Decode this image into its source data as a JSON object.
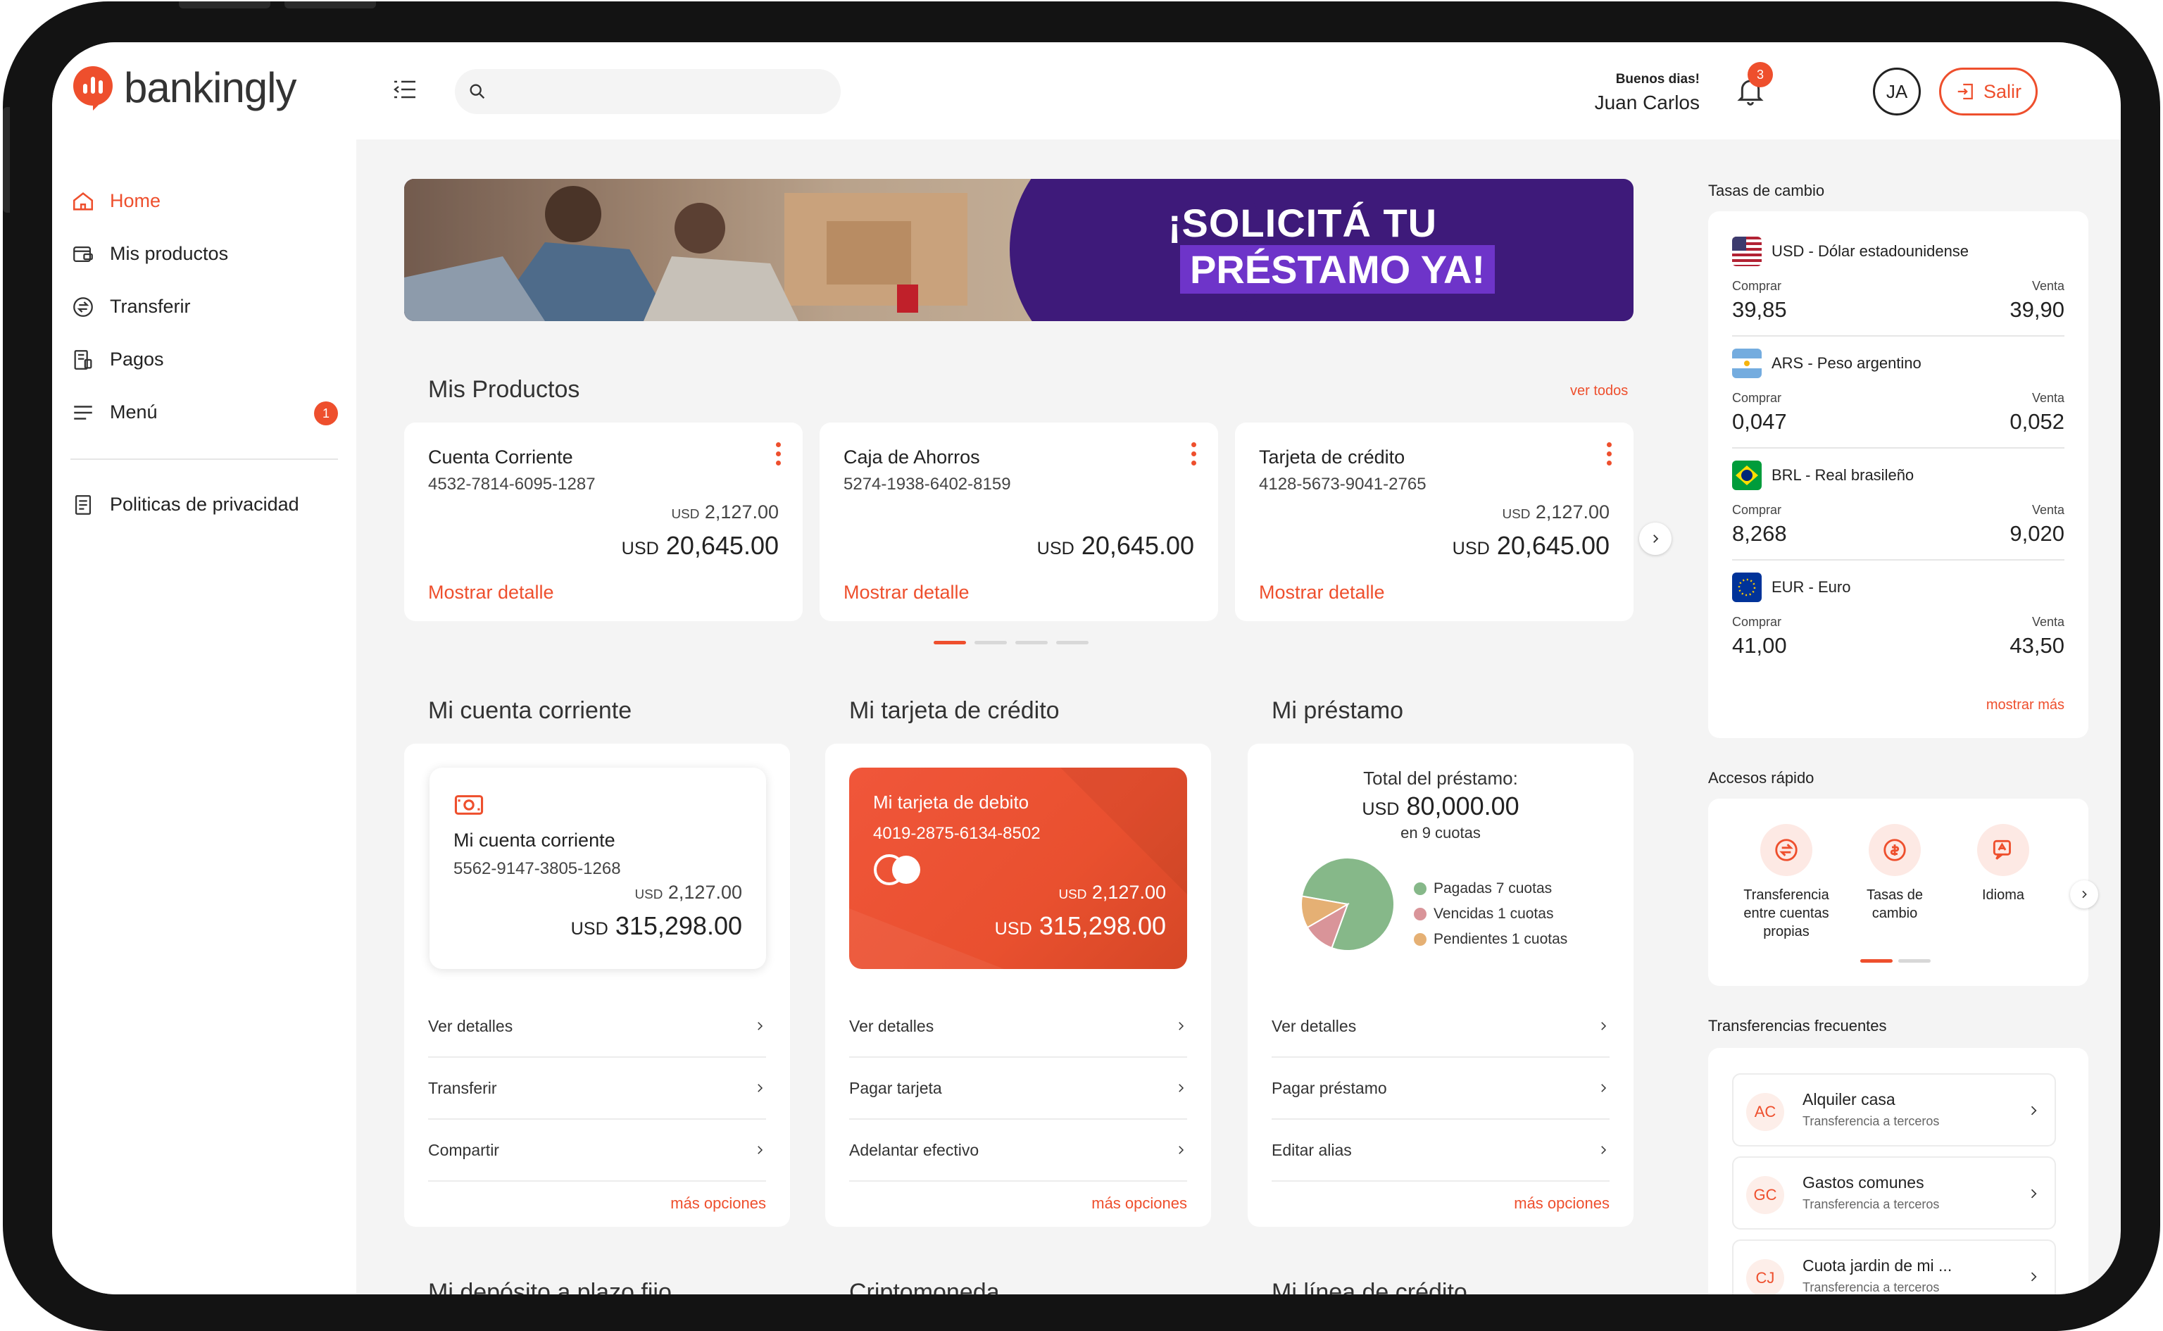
{
  "app": {
    "logo_text": "bankingly"
  },
  "sidebar": {
    "items": [
      {
        "label": "Home",
        "icon": "home-icon",
        "active": true
      },
      {
        "label": "Mis productos",
        "icon": "wallet-icon"
      },
      {
        "label": "Transferir",
        "icon": "transfer-icon"
      },
      {
        "label": "Pagos",
        "icon": "receipt-icon"
      },
      {
        "label": "Menú",
        "icon": "menu-icon",
        "badge": "1"
      }
    ],
    "privacy": {
      "label": "Politicas de privacidad",
      "icon": "document-icon"
    }
  },
  "header": {
    "search_placeholder": "",
    "notifications_count": "3",
    "greeting": "Buenos dias!",
    "user_name": "Juan Carlos",
    "user_initials": "JA",
    "logout_label": "Salir"
  },
  "banner": {
    "line1": "¡SOLICITÁ TU",
    "line2": "PRÉSTAMO YA!"
  },
  "mis_productos": {
    "title": "Mis Productos",
    "see_all": "ver todos",
    "cards": [
      {
        "name": "Cuenta Corriente",
        "number": "4532-7814-6095-1287",
        "small_currency": "USD",
        "small_amount": "2,127.00",
        "big_currency": "USD",
        "big_amount": "20,645.00",
        "link": "Mostrar detalle"
      },
      {
        "name": "Caja de Ahorros",
        "number": "5274-1938-6402-8159",
        "big_currency": "USD",
        "big_amount": "20,645.00",
        "link": "Mostrar detalle"
      },
      {
        "name": "Tarjeta de crédito",
        "number": "4128-5673-9041-2765",
        "small_currency": "USD",
        "small_amount": "2,127.00",
        "big_currency": "USD",
        "big_amount": "20,645.00",
        "link": "Mostrar detalle"
      }
    ]
  },
  "cuenta_corriente": {
    "title": "Mi cuenta corriente",
    "card_name": "Mi cuenta corriente",
    "card_number": "5562-9147-3805-1268",
    "small_currency": "USD",
    "small_amount": "2,127.00",
    "big_currency": "USD",
    "big_amount": "315,298.00",
    "options": [
      "Ver detalles",
      "Transferir",
      "Compartir"
    ],
    "more": "más opciones"
  },
  "tarjeta_credito": {
    "title": "Mi tarjeta de crédito",
    "card_name": "Mi tarjeta de debito",
    "card_number": "4019-2875-6134-8502",
    "small_currency": "USD",
    "small_amount": "2,127.00",
    "big_currency": "USD",
    "big_amount": "315,298.00",
    "options": [
      "Ver detalles",
      "Pagar tarjeta",
      "Adelantar efectivo"
    ],
    "more": "más opciones",
    "card_color": "#ee4f2d"
  },
  "prestamo": {
    "title": "Mi préstamo",
    "total_label": "Total del préstamo:",
    "total_currency": "USD",
    "total_amount": "80,000.00",
    "installments": "en 9 cuotas",
    "legend": [
      {
        "label": "Pagadas 7 cuotas",
        "value": 7,
        "color": "#86b889"
      },
      {
        "label": "Vencidas 1 cuotas",
        "value": 1,
        "color": "#d99499"
      },
      {
        "label": "Pendientes 1 cuotas",
        "value": 1,
        "color": "#e5b074"
      }
    ],
    "options": [
      "Ver detalles",
      "Pagar préstamo",
      "Editar alias"
    ],
    "more": "más opciones"
  },
  "peek_titles": [
    "Mi depósito a plazo fijo",
    "Criptomoneda",
    "Mi línea de crédito"
  ],
  "tasas": {
    "title": "Tasas de cambio",
    "buy_label": "Comprar",
    "sell_label": "Venta",
    "rates": [
      {
        "name": "USD - Dólar estadounidense",
        "buy": "39,85",
        "sell": "39,90",
        "flag": "us-flag-icon"
      },
      {
        "name": "ARS - Peso argentino",
        "buy": "0,047",
        "sell": "0,052",
        "flag": "ar-flag-icon"
      },
      {
        "name": "BRL - Real brasileño",
        "buy": "8,268",
        "sell": "9,020",
        "flag": "br-flag-icon"
      },
      {
        "name": "EUR - Euro",
        "buy": "41,00",
        "sell": "43,50",
        "flag": "eu-flag-icon"
      }
    ],
    "more": "mostrar más"
  },
  "accesos": {
    "title": "Accesos rápido",
    "items": [
      {
        "label": "Transferencia entre cuentas propias",
        "icon": "transfer-icon"
      },
      {
        "label": "Tasas de cambio",
        "icon": "exchange-icon"
      },
      {
        "label": "Idioma",
        "icon": "language-icon"
      }
    ]
  },
  "frecuentes": {
    "title": "Transferencias frecuentes",
    "items": [
      {
        "initials": "AC",
        "name": "Alquiler casa",
        "sub": "Transferencia a terceros"
      },
      {
        "initials": "GC",
        "name": "Gastos comunes",
        "sub": "Transferencia a terceros"
      },
      {
        "initials": "CJ",
        "name": "Cuota jardin de mi ...",
        "sub": "Transferencia a terceros"
      }
    ]
  },
  "colors": {
    "accent": "#ee4f2d",
    "banner": "#3e1a7a",
    "background": "#f4f4f4"
  }
}
